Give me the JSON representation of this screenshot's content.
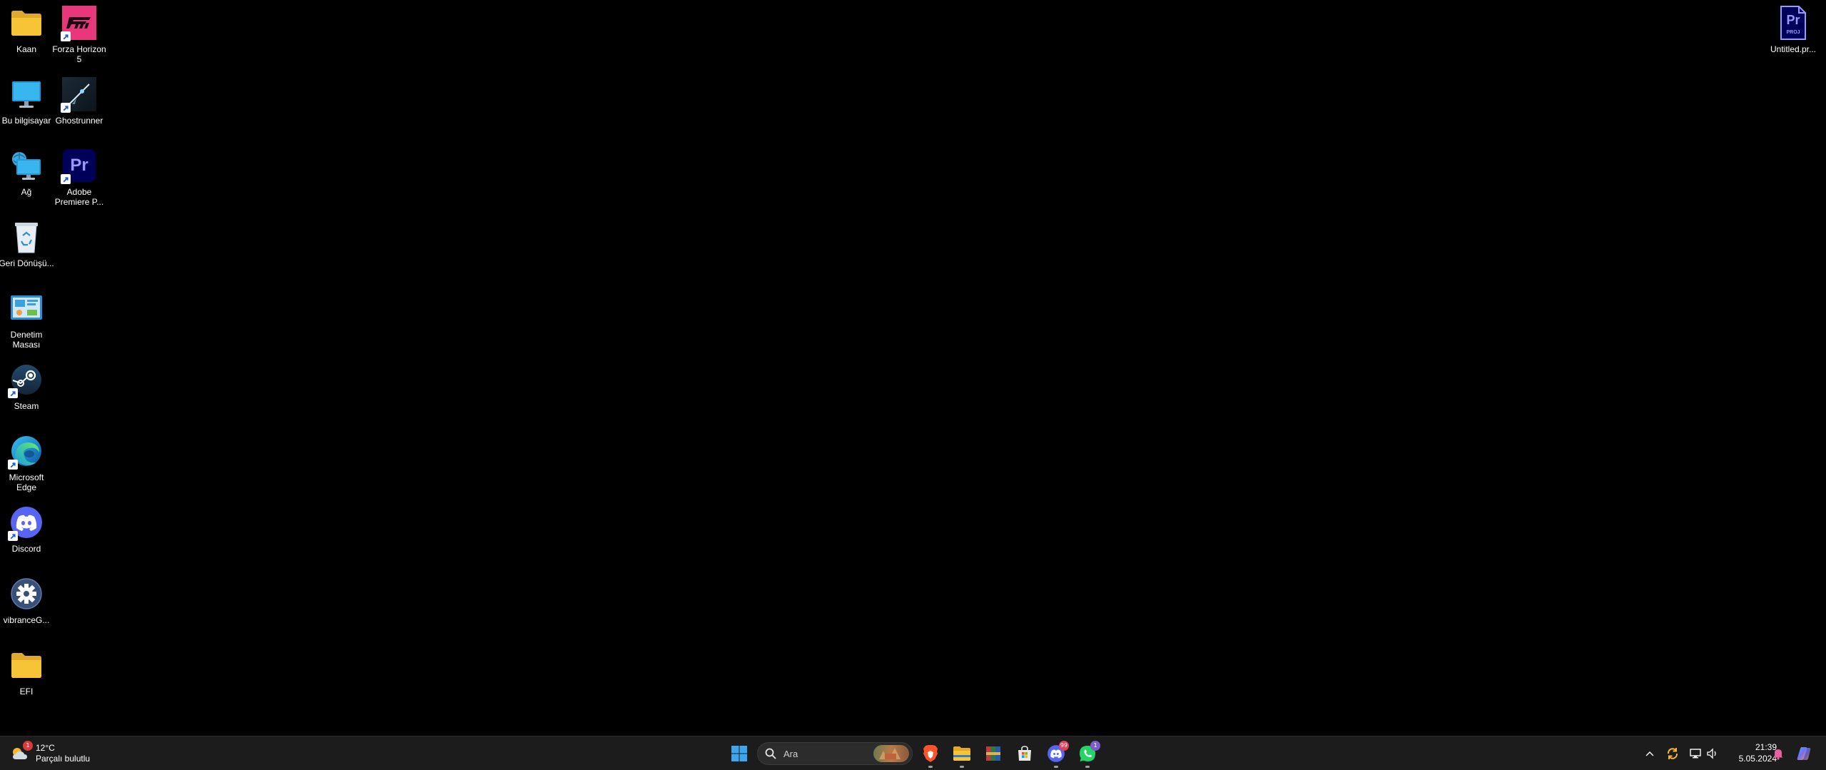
{
  "desktop": {
    "icons": [
      {
        "label": "Kaan",
        "icon": "folder-icon"
      },
      {
        "label": "Forza Horizon 5",
        "icon": "forza-horizon-icon"
      },
      {
        "label": "Bu bilgisayar",
        "icon": "computer-icon"
      },
      {
        "label": "Ghostrunner",
        "icon": "ghostrunner-icon"
      },
      {
        "label": "Ağ",
        "icon": "network-icon"
      },
      {
        "label": "Adobe Premiere P...",
        "icon": "premiere-pro-icon",
        "glyph": "Pr"
      },
      {
        "label": "Geri Dönüşü...",
        "icon": "recycle-bin-icon"
      },
      {
        "label": "Denetim Masası",
        "icon": "control-panel-icon"
      },
      {
        "label": "Steam",
        "icon": "steam-icon"
      },
      {
        "label": "Microsoft Edge",
        "icon": "edge-icon"
      },
      {
        "label": "Discord",
        "icon": "discord-icon"
      },
      {
        "label": "vibranceG...",
        "icon": "gear-icon"
      },
      {
        "label": "EFI",
        "icon": "folder-icon"
      },
      {
        "label": "Untitled.pr...",
        "icon": "premiere-project-icon",
        "glyph": "Pr",
        "sub": "PROJ"
      }
    ]
  },
  "taskbar": {
    "weather": {
      "temp": "12°C",
      "condition": "Parçalı bulutlu",
      "alert_count": "1"
    },
    "search": {
      "placeholder": "Ara"
    },
    "apps": [
      {
        "name": "start-button"
      },
      {
        "name": "brave-browser-button"
      },
      {
        "name": "file-explorer-button"
      },
      {
        "name": "winrar-button"
      },
      {
        "name": "microsoft-store-button"
      },
      {
        "name": "discord-button",
        "badge": "99"
      },
      {
        "name": "whatsapp-button",
        "badge": "1"
      }
    ],
    "clock": {
      "time": "21:39",
      "date": "5.05.2024"
    }
  },
  "colors": {
    "desktop_bg": "#000000",
    "taskbar_bg": "#1c1c1c",
    "premiere_blue": "#00005b",
    "premiere_text": "#9999ff",
    "forza_pink": "#e8377a",
    "discord_blurple": "#5865f2",
    "whatsapp_green": "#25d366",
    "folder_yellow": "#f8c437"
  }
}
